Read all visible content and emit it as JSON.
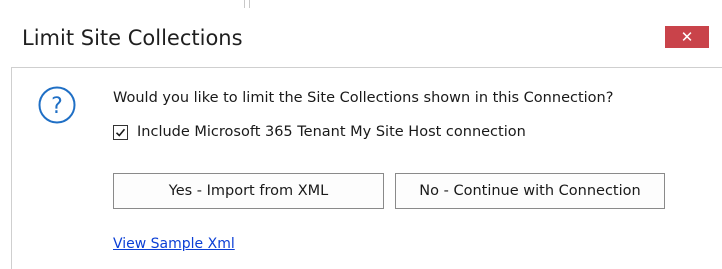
{
  "dialog": {
    "title": "Limit Site Collections",
    "close_label": "✕",
    "prompt": "Would you like to limit the Site Collections shown in this Connection?",
    "checkbox": {
      "label": "Include Microsoft 365 Tenant My Site Host connection",
      "checked": true
    },
    "buttons": {
      "yes_label": "Yes - Import from XML",
      "no_label": "No - Continue with Connection"
    },
    "link_label": "View Sample Xml",
    "icon": "question-icon"
  },
  "colors": {
    "close_bg": "#c9434a",
    "icon_blue": "#1f6fc5",
    "link": "#0b3fd6",
    "border": "#8a8a8a"
  }
}
